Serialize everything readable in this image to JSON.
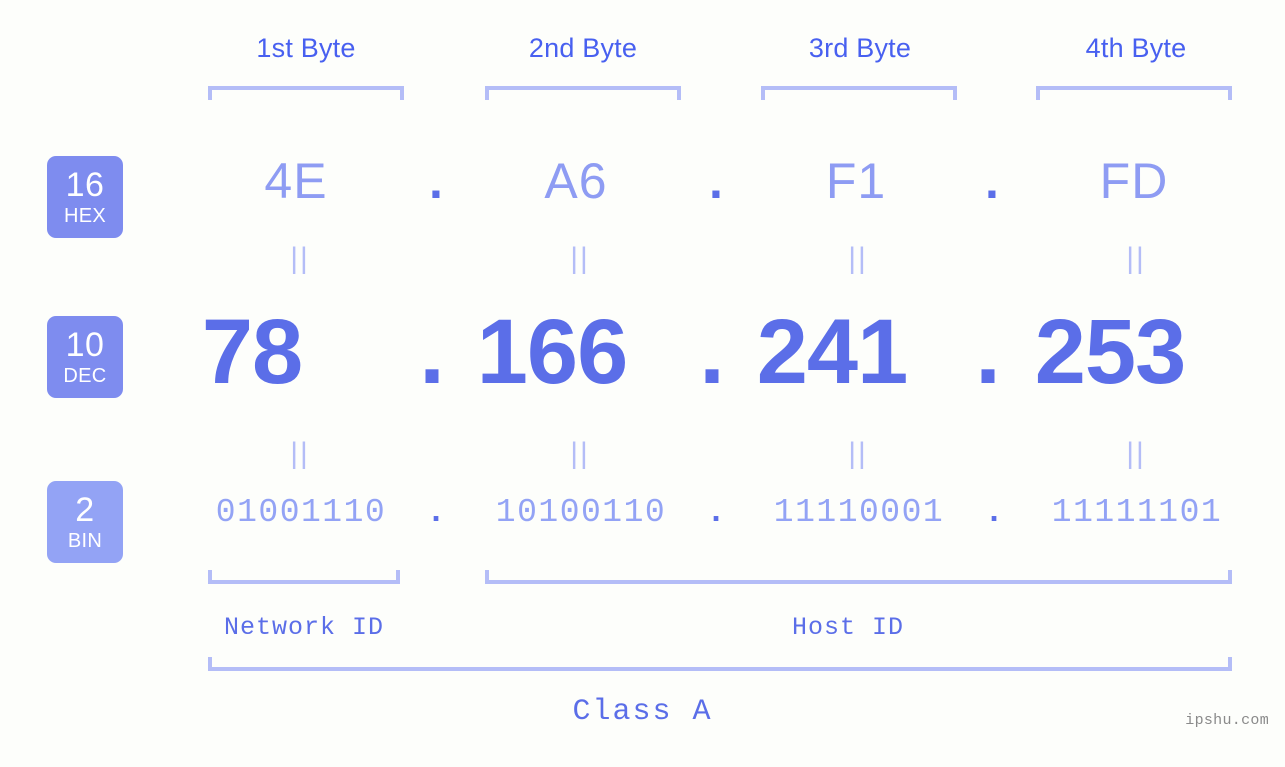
{
  "background_color": "#fdfefb",
  "colors": {
    "accent_strong": "#5b6ee8",
    "accent_light": "#8e9cf3",
    "accent_pale": "#b4bdf7",
    "header_blue": "#4860f0",
    "badge_fill": "#7e8cef",
    "badge_fill_light": "#93a3f5",
    "watermark_gray": "#8a8a8a"
  },
  "byte_headers": [
    {
      "label": "1st Byte"
    },
    {
      "label": "2nd Byte"
    },
    {
      "label": "3rd Byte"
    },
    {
      "label": "4th Byte"
    }
  ],
  "bases": [
    {
      "number": "16",
      "name": "HEX"
    },
    {
      "number": "10",
      "name": "DEC"
    },
    {
      "number": "2",
      "name": "BIN"
    }
  ],
  "rows": {
    "hex": {
      "values": [
        "4E",
        "A6",
        "F1",
        "FD"
      ],
      "separator": "."
    },
    "dec": {
      "values": [
        "78",
        "166",
        "241",
        "253"
      ],
      "separator": "."
    },
    "bin": {
      "values": [
        "01001110",
        "10100110",
        "11110001",
        "11111101"
      ],
      "separator": "."
    }
  },
  "equality_marks": [
    "||",
    "||",
    "||",
    "||",
    "||",
    "||",
    "||",
    "||"
  ],
  "segments": {
    "network": {
      "label": "Network ID"
    },
    "host": {
      "label": "Host ID"
    }
  },
  "class": {
    "label": "Class A"
  },
  "watermark": {
    "text": "ipshu.com"
  }
}
